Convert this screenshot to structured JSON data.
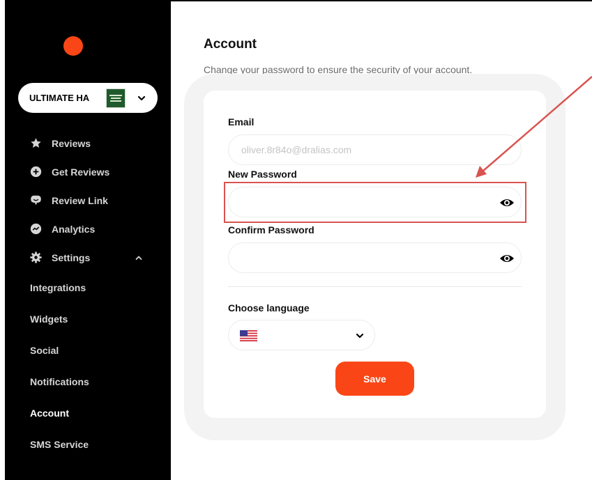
{
  "colors": {
    "accent": "#fa4616",
    "sidebar_bg": "#000000",
    "annotation": "#d9534f"
  },
  "sidebar": {
    "business_name": "ULTIMATE HA",
    "nav": [
      {
        "label": "Reviews",
        "icon": "star-icon"
      },
      {
        "label": "Get Reviews",
        "icon": "plus-circle-icon"
      },
      {
        "label": "Review Link",
        "icon": "chat-icon"
      },
      {
        "label": "Analytics",
        "icon": "chart-circle-icon"
      },
      {
        "label": "Settings",
        "icon": "gear-icon"
      }
    ],
    "settings_sub": [
      "Integrations",
      "Widgets",
      "Social",
      "Notifications",
      "Account",
      "SMS Service"
    ],
    "active": "Account"
  },
  "main": {
    "title": "Account",
    "subtitle": "Change your password to ensure the security of your account.",
    "email_label": "Email",
    "email_placeholder": "oliver.8r84o@dralias.com",
    "new_password_label": "New Password",
    "confirm_password_label": "Confirm Password",
    "language_label": "Choose language",
    "language_value": "us-flag-icon",
    "save_label": "Save"
  }
}
